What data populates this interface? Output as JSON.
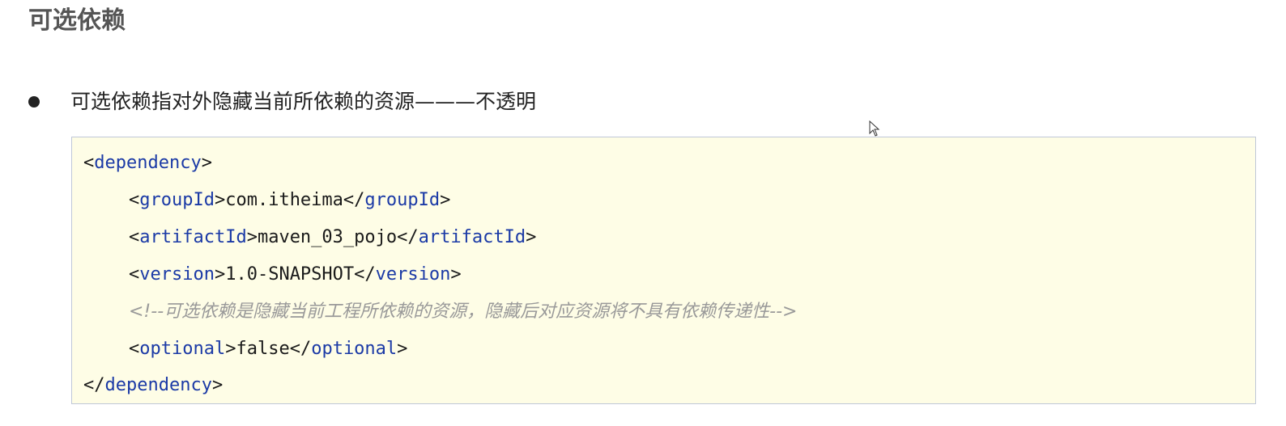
{
  "heading": "可选依赖",
  "bullet": {
    "text": "可选依赖指对外隐藏当前所依赖的资源———不透明"
  },
  "code": {
    "dependency_tag": "dependency",
    "groupId_tag": "groupId",
    "groupId_value": "com.itheima",
    "artifactId_tag": "artifactId",
    "artifactId_value": "maven_03_pojo",
    "version_tag": "version",
    "version_value": "1.0-SNAPSHOT",
    "comment": "<!--可选依赖是隐藏当前工程所依赖的资源，隐藏后对应资源将不具有依赖传递性-->",
    "optional_tag": "optional",
    "optional_value": "false"
  },
  "icons": {
    "cursor": "mouse-pointer-icon"
  },
  "colors": {
    "code_background": "#fefde6",
    "tag_color": "#1b3aa6",
    "comment_color": "#999999"
  }
}
